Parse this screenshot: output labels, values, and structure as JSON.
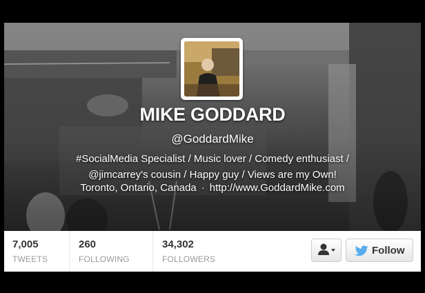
{
  "profile": {
    "name": "MIKE GODDARD",
    "handle": "@GoddardMike",
    "bio_line1": "#SocialMedia Specialist / Music lover / Comedy enthusiast /",
    "bio_line2": "@jimcarrey's cousin / Happy guy / Views are my Own!",
    "location": "Toronto, Ontario, Canada",
    "separator": "·",
    "website": "http://www.GoddardMike.com",
    "avatar_icon": "profile-photo"
  },
  "stats": [
    {
      "value": "7,005",
      "label": "TWEETS"
    },
    {
      "value": "260",
      "label": "FOLLOWING"
    },
    {
      "value": "34,302",
      "label": "FOLLOWERS"
    }
  ],
  "actions": {
    "user_menu_icon": "user-dropdown-icon",
    "follow_label": "Follow",
    "follow_icon": "twitter-bird-icon"
  },
  "colors": {
    "twitter_blue": "#55acee",
    "label_gray": "#999999",
    "text_dark": "#333333"
  }
}
